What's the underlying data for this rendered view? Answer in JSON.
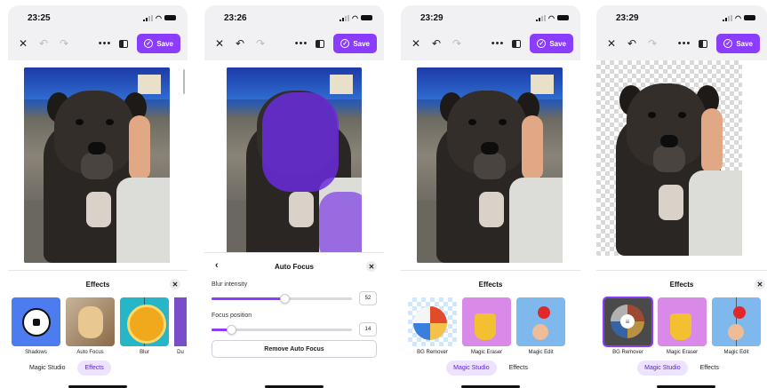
{
  "colors": {
    "accent": "#8b3dff",
    "accent_light": "#ede3ff",
    "panel_bg": "#ffffff"
  },
  "toolbar": {
    "save_label": "Save",
    "close_icon": "close-icon",
    "undo_icon": "undo-icon",
    "redo_icon": "redo-icon",
    "more_icon": "more-icon",
    "compare_icon": "compare-icon"
  },
  "screens": [
    {
      "time": "23:25",
      "panel_title": "Effects",
      "effects": [
        {
          "label": "Shadows"
        },
        {
          "label": "Auto Focus"
        },
        {
          "label": "Blur"
        },
        {
          "label": "Du"
        }
      ],
      "tabs": [
        {
          "label": "Magic Studio",
          "active": false
        },
        {
          "label": "Effects",
          "active": true
        }
      ]
    },
    {
      "time": "23:26",
      "panel_title": "Auto Focus",
      "sliders": [
        {
          "label": "Blur intensity",
          "value": "52",
          "level": 0.52
        },
        {
          "label": "Focus position",
          "value": "14",
          "level": 0.14
        }
      ],
      "remove_label": "Remove Auto Focus"
    },
    {
      "time": "23:29",
      "panel_title": "Effects",
      "effects": [
        {
          "label": "BG Remover"
        },
        {
          "label": "Magic Eraser"
        },
        {
          "label": "Magic Edit"
        }
      ],
      "tabs": [
        {
          "label": "Magic Studio",
          "active": true
        },
        {
          "label": "Effects",
          "active": false
        }
      ]
    },
    {
      "time": "23:29",
      "panel_title": "Effects",
      "effects": [
        {
          "label": "BG Remover",
          "selected": true
        },
        {
          "label": "Magic Eraser"
        },
        {
          "label": "Magic Edit"
        }
      ],
      "tabs": [
        {
          "label": "Magic Studio",
          "active": true
        },
        {
          "label": "Effects",
          "active": false
        }
      ]
    }
  ]
}
